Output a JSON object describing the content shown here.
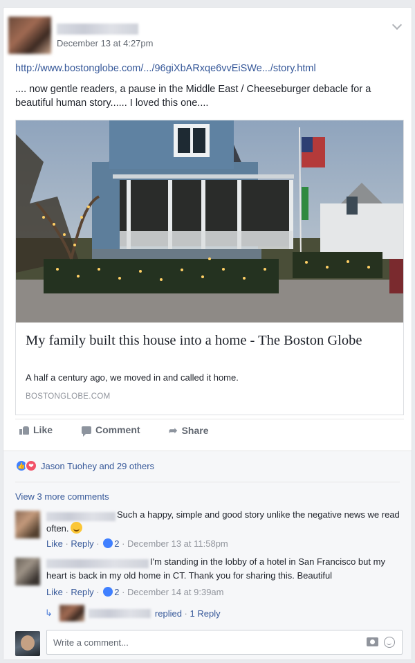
{
  "post": {
    "date": "December 13 at 4:27pm",
    "link_text": "http://www.bostonglobe.com/.../96giXbARxqe6vvEiSWe.../story.html",
    "message": ".... now gentle readers, a pause in the Middle East / Cheeseburger debacle for a beautiful human story...... I loved this one...."
  },
  "preview": {
    "title": "My family built this house into a home - The Boston Globe",
    "subtitle": "A half a century ago, we moved in and called it home.",
    "source": "BOSTONGLOBE.COM"
  },
  "actions": {
    "like": "Like",
    "comment": "Comment",
    "share": "Share"
  },
  "reactions": {
    "text": "Jason Tuohey and 29 others"
  },
  "comments": {
    "view_more": "View 3 more comments",
    "items": [
      {
        "text": "Such a happy, simple and good story unlike the negative news we read often.",
        "like": "Like",
        "reply": "Reply",
        "likes": "2",
        "date": "December 13 at 11:58pm"
      },
      {
        "text": "I'm standing in the lobby of a hotel in San Francisco but my heart is back in my old home in CT. Thank you for sharing this. Beautiful",
        "like": "Like",
        "reply": "Reply",
        "likes": "2",
        "date": "December 14 at 9:39am"
      }
    ],
    "reply_summary": {
      "replied": "replied",
      "count": "1 Reply"
    },
    "write_placeholder": "Write a comment..."
  },
  "icons": {
    "chevron": "chevron-down-icon",
    "like": "thumbs-up-icon",
    "comment": "speech-bubble-icon",
    "share": "share-arrow-icon",
    "camera": "camera-icon",
    "emoji": "smiley-icon"
  },
  "colors": {
    "link": "#365899",
    "like_reaction": "#4080ff",
    "love_reaction": "#f25268"
  }
}
